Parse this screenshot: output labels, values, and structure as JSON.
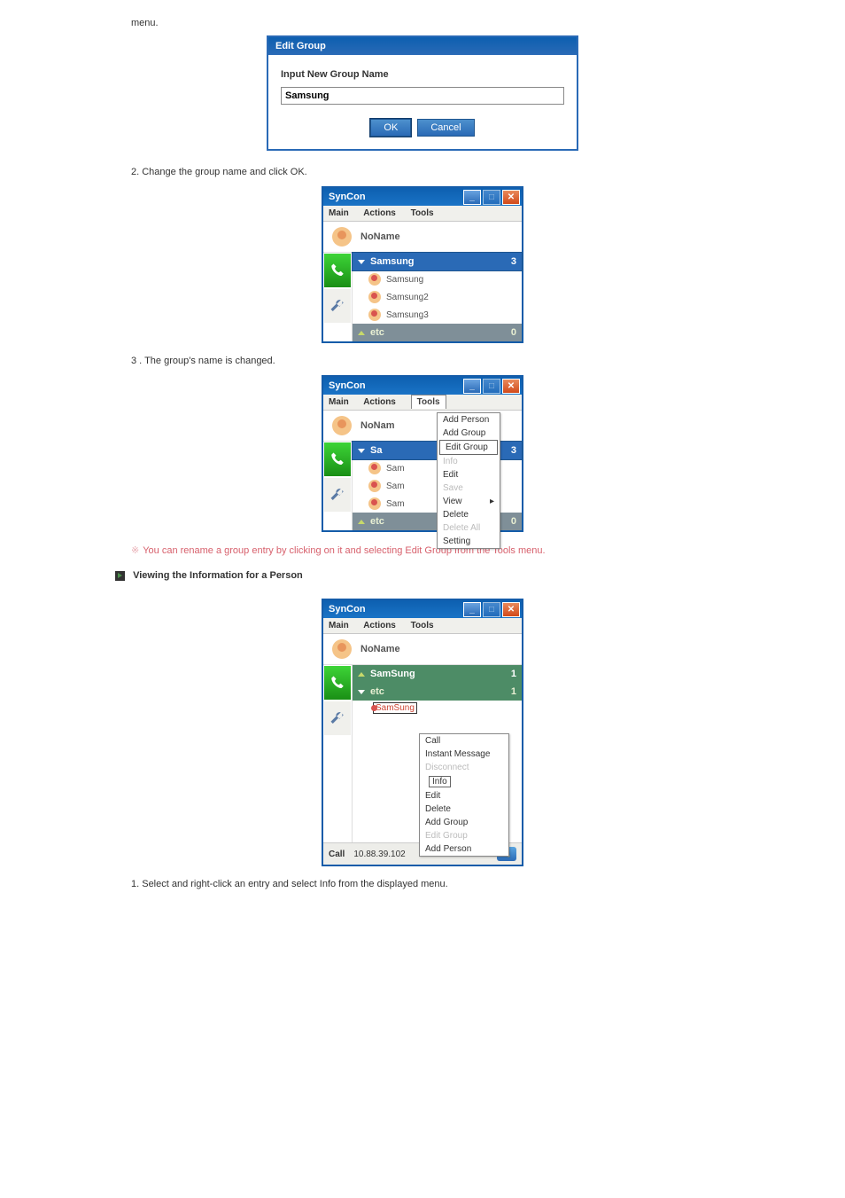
{
  "preface_text": "menu.",
  "edit_group_dialog": {
    "title": "Edit Group",
    "label": "Input New Group Name",
    "value": "Samsung",
    "ok": "OK",
    "cancel": "Cancel"
  },
  "step2": "2. Change the group name and click OK.",
  "step3": "3 . The group's name is changed.",
  "note_text": "You can rename a group entry by clicking on it and selecting Edit Group from the Tools menu.",
  "viewing_heading": "Viewing the Information for a Person",
  "step1_info": "1. Select and right-click an entry and select Info from the displayed menu.",
  "syncon_title": "SynCon",
  "menubar": {
    "main": "Main",
    "actions": "Actions",
    "tools": "Tools"
  },
  "user_name": "NoName",
  "user_name_trunc": "NoNam",
  "window1": {
    "group_name": "Samsung",
    "group_count": "3",
    "people": [
      "Samsung",
      "Samsung2",
      "Samsung3"
    ],
    "etc_label": "etc",
    "etc_count": "0"
  },
  "tools_menu": {
    "items": [
      {
        "label": "Add Person",
        "disabled": false
      },
      {
        "label": "Add Group",
        "disabled": false
      },
      {
        "label": "Edit Group",
        "disabled": false,
        "boxed": true
      },
      {
        "label": "Info",
        "disabled": true
      },
      {
        "label": "Edit",
        "disabled": false
      },
      {
        "label": "Save",
        "disabled": true
      },
      {
        "label": "View",
        "disabled": false,
        "submenu": true
      },
      {
        "label": "Delete",
        "disabled": false
      },
      {
        "label": "Delete All",
        "disabled": true
      },
      {
        "label": "Setting",
        "disabled": false
      }
    ]
  },
  "window2_people_trunc": "Sam",
  "window2_group_trunc": "Sa",
  "window3": {
    "group1": "SamSung",
    "group1_count": "1",
    "group2": "etc",
    "group2_count": "1",
    "selected_person": "SamSung",
    "context": [
      {
        "label": "Call"
      },
      {
        "label": "Instant Message"
      },
      {
        "label": "Disconnect",
        "disabled": true
      },
      {
        "label": "Info",
        "boxed": true
      },
      {
        "label": "Edit"
      },
      {
        "label": "Delete"
      },
      {
        "label": "Add Group"
      },
      {
        "label": "Edit Group",
        "disabled": true
      },
      {
        "label": "Add Person"
      }
    ],
    "call_label": "Call",
    "call_ip": "10.88.39.102"
  }
}
